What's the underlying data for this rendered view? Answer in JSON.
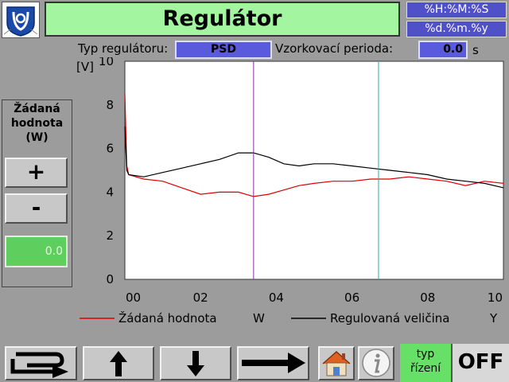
{
  "header": {
    "title": "Regulátor",
    "time_format": "%H:%M:%S",
    "date_format": "%d.%m.%y"
  },
  "params": {
    "regulator_type_label": "Typ regulátoru:",
    "regulator_type_value": "PSD",
    "sampling_period_label": "Vzorkovací perioda:",
    "sampling_period_value": "0.0",
    "sampling_period_unit": "s"
  },
  "setpoint_panel": {
    "title_line1": "Žádaná",
    "title_line2": "hodnota",
    "title_line3": "(W)",
    "plus_label": "+",
    "minus_label": "-",
    "value": "0.0"
  },
  "toolbar": {
    "control_mode_line1": "typ",
    "control_mode_line2": "řízení",
    "state_label": "OFF",
    "icons": [
      "return-arrow-icon",
      "up-arrow-icon",
      "down-arrow-icon",
      "right-arrow-icon",
      "home-icon",
      "info-icon"
    ]
  },
  "colors": {
    "title_bg": "#a3f5a0",
    "datetime_bg": "#5050c8",
    "param_bg": "#5a5adc",
    "setpoint_bg": "#5ece5e",
    "mode_bg": "#66e066",
    "setpoint_series": "#dd0000",
    "controlled_series": "#000000",
    "cursor1": "#8a2aa8",
    "cursor2": "#20b0c0"
  },
  "chart_data": {
    "type": "line",
    "yunit": "[V]",
    "ylim": [
      0,
      10
    ],
    "yticks": [
      "0",
      "2",
      "4",
      "6",
      "8",
      "10"
    ],
    "xlim": [
      0,
      10
    ],
    "xticks": [
      "00",
      "02",
      "04",
      "06",
      "08",
      "10"
    ],
    "grid": false,
    "cursors_x": [
      3.4,
      6.7
    ],
    "series": [
      {
        "name": "Žádaná hodnota",
        "symbol": "W",
        "color": "#dd0000",
        "x": [
          0,
          0.05,
          0.1,
          0.5,
          1.0,
          1.5,
          2.0,
          2.5,
          3.0,
          3.4,
          3.8,
          4.2,
          4.6,
          5.0,
          5.5,
          6.0,
          6.5,
          7.0,
          7.5,
          8.0,
          8.5,
          9.0,
          9.5,
          10.0
        ],
        "values": [
          8.5,
          5.2,
          4.8,
          4.6,
          4.5,
          4.2,
          3.9,
          4.0,
          4.0,
          3.8,
          3.9,
          4.1,
          4.3,
          4.4,
          4.5,
          4.5,
          4.6,
          4.6,
          4.7,
          4.6,
          4.5,
          4.3,
          4.5,
          4.4
        ]
      },
      {
        "name": "Regulovaná veličina",
        "symbol": "Y",
        "color": "#000000",
        "x": [
          0,
          0.05,
          0.1,
          0.5,
          1.0,
          1.5,
          2.0,
          2.5,
          3.0,
          3.4,
          3.8,
          4.2,
          4.6,
          5.0,
          5.5,
          6.0,
          6.5,
          7.0,
          7.5,
          8.0,
          8.5,
          9.0,
          9.5,
          10.0
        ],
        "values": [
          7.0,
          5.0,
          4.8,
          4.7,
          4.9,
          5.1,
          5.3,
          5.5,
          5.8,
          5.8,
          5.6,
          5.3,
          5.2,
          5.3,
          5.3,
          5.2,
          5.1,
          5.0,
          4.9,
          4.8,
          4.6,
          4.5,
          4.4,
          4.2
        ]
      }
    ]
  }
}
